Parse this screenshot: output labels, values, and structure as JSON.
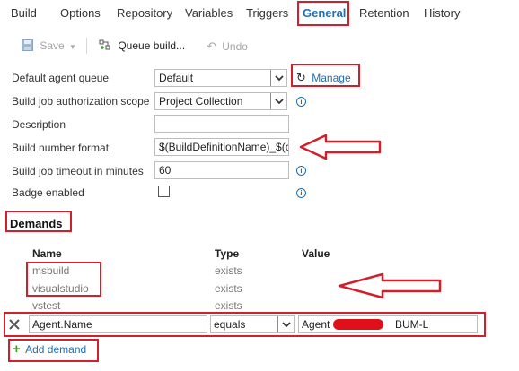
{
  "tabs": [
    {
      "label": "Build"
    },
    {
      "label": "Options"
    },
    {
      "label": "Repository"
    },
    {
      "label": "Variables"
    },
    {
      "label": "Triggers"
    },
    {
      "label": "General"
    },
    {
      "label": "Retention"
    },
    {
      "label": "History"
    }
  ],
  "toolbar": {
    "save_label": "Save",
    "queue_label": "Queue build...",
    "undo_label": "Undo"
  },
  "form": {
    "queue": {
      "label": "Default agent queue",
      "value": "Default",
      "manage_label": "Manage"
    },
    "scope": {
      "label": "Build job authorization scope",
      "value": "Project Collection"
    },
    "description": {
      "label": "Description",
      "value": ""
    },
    "number_format": {
      "label": "Build number format",
      "value": "$(BuildDefinitionName)_$(c"
    },
    "timeout": {
      "label": "Build job timeout in minutes",
      "value": "60"
    },
    "badge": {
      "label": "Badge enabled",
      "checked": false
    }
  },
  "demands": {
    "title": "Demands",
    "headers": {
      "name": "Name",
      "type": "Type",
      "value": "Value"
    },
    "rows": [
      {
        "name": "msbuild",
        "type": "exists"
      },
      {
        "name": "visualstudio",
        "type": "exists"
      },
      {
        "name": "vstest",
        "type": "exists"
      }
    ],
    "edit_row": {
      "name": "Agent.Name",
      "type": "equals",
      "value_prefix": "Agent",
      "value_suffix": "BUM-L"
    },
    "add_label": "Add demand"
  },
  "colors": {
    "accent": "#1f6fb5",
    "highlight": "#d0202c",
    "add_icon": "#3a9b2d"
  }
}
